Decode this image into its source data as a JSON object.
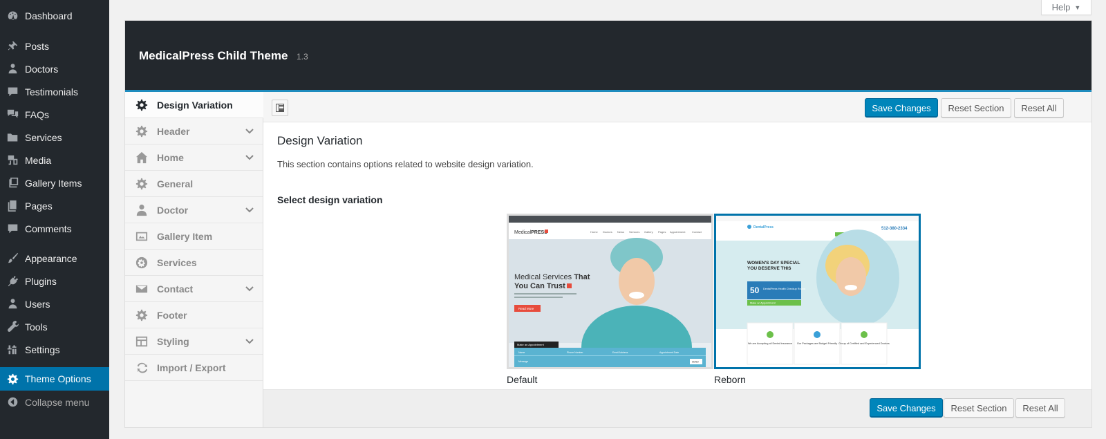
{
  "admin_menu": {
    "items": [
      {
        "label": "Dashboard",
        "icon": "dashboard-icon"
      },
      {
        "label": "Posts",
        "icon": "pin-icon"
      },
      {
        "label": "Doctors",
        "icon": "person-icon"
      },
      {
        "label": "Testimonials",
        "icon": "comment-icon"
      },
      {
        "label": "FAQs",
        "icon": "comments-icon"
      },
      {
        "label": "Services",
        "icon": "folder-icon"
      },
      {
        "label": "Media",
        "icon": "media-icon"
      },
      {
        "label": "Gallery Items",
        "icon": "gallery-icon"
      },
      {
        "label": "Pages",
        "icon": "page-icon"
      },
      {
        "label": "Comments",
        "icon": "comment-icon"
      },
      {
        "label": "Appearance",
        "icon": "brush-icon"
      },
      {
        "label": "Plugins",
        "icon": "plug-icon"
      },
      {
        "label": "Users",
        "icon": "person-icon"
      },
      {
        "label": "Tools",
        "icon": "wrench-icon"
      },
      {
        "label": "Settings",
        "icon": "settings-icon"
      },
      {
        "label": "Theme Options",
        "icon": "gear-icon"
      },
      {
        "label": "Collapse menu",
        "icon": "collapse-icon"
      }
    ]
  },
  "help_tab": {
    "label": "Help"
  },
  "panel": {
    "title": "MedicalPress Child Theme",
    "version": "1.3",
    "nav": [
      {
        "label": "Design Variation",
        "icon": "gear-icon",
        "active": true,
        "has_children": false
      },
      {
        "label": "Header",
        "icon": "gear-icon",
        "has_children": true
      },
      {
        "label": "Home",
        "icon": "home-icon",
        "has_children": true
      },
      {
        "label": "General",
        "icon": "gear-icon",
        "has_children": false
      },
      {
        "label": "Doctor",
        "icon": "person-icon",
        "has_children": true
      },
      {
        "label": "Gallery Item",
        "icon": "image-icon",
        "has_children": false
      },
      {
        "label": "Services",
        "icon": "settings-circle-icon",
        "has_children": false
      },
      {
        "label": "Contact",
        "icon": "envelope-icon",
        "has_children": true
      },
      {
        "label": "Footer",
        "icon": "gear-icon",
        "has_children": false
      },
      {
        "label": "Styling",
        "icon": "layout-icon",
        "has_children": true
      },
      {
        "label": "Import / Export",
        "icon": "refresh-icon",
        "has_children": false
      }
    ],
    "buttons": {
      "save": "Save Changes",
      "reset_section": "Reset Section",
      "reset_all": "Reset All"
    },
    "section": {
      "title": "Design Variation",
      "description": "This section contains options related to website design variation.",
      "field_label": "Select design variation",
      "options": [
        {
          "label": "Default",
          "selected": false,
          "thumb": {
            "logo_a": "Medical",
            "logo_b": "PRESS",
            "headline_a": "Medical Services",
            "headline_b": "That",
            "headline_c": "You Can Trust",
            "button": "Read More",
            "appointment": "Make an Appointment",
            "field_1": "Name",
            "field_2": "Phone Number",
            "field_3": "Email Address",
            "field_4": "Appointment Date",
            "field_5": "Message",
            "send": "SEND",
            "nav": [
              "Home",
              "Doctors",
              "News",
              "Services",
              "Gallery",
              "Pages",
              "Appointment",
              "Contact"
            ]
          }
        },
        {
          "label": "Reborn",
          "selected": true,
          "thumb": {
            "logo": "DentalPress",
            "phone": "512-380-2334",
            "headline_a": "WOMEN'S DAY SPECIAL",
            "headline_b": "YOU DESERVE THIS",
            "badge_num": "50",
            "badge_text": "DentalPress Health Checkup Round",
            "cta": "Make an Appointment",
            "feature_1": "We are Accepting all Dental Insurance",
            "feature_2": "Our Packages are Budget Friendly",
            "feature_3": "Group of Certified and Experienced Doctors"
          }
        }
      ]
    }
  },
  "colors": {
    "admin_bg": "#23282d",
    "admin_active": "#0073aa",
    "primary_button": "#0085ba",
    "panel_header": "#23282d",
    "accent_border": "#1e8cbe"
  }
}
